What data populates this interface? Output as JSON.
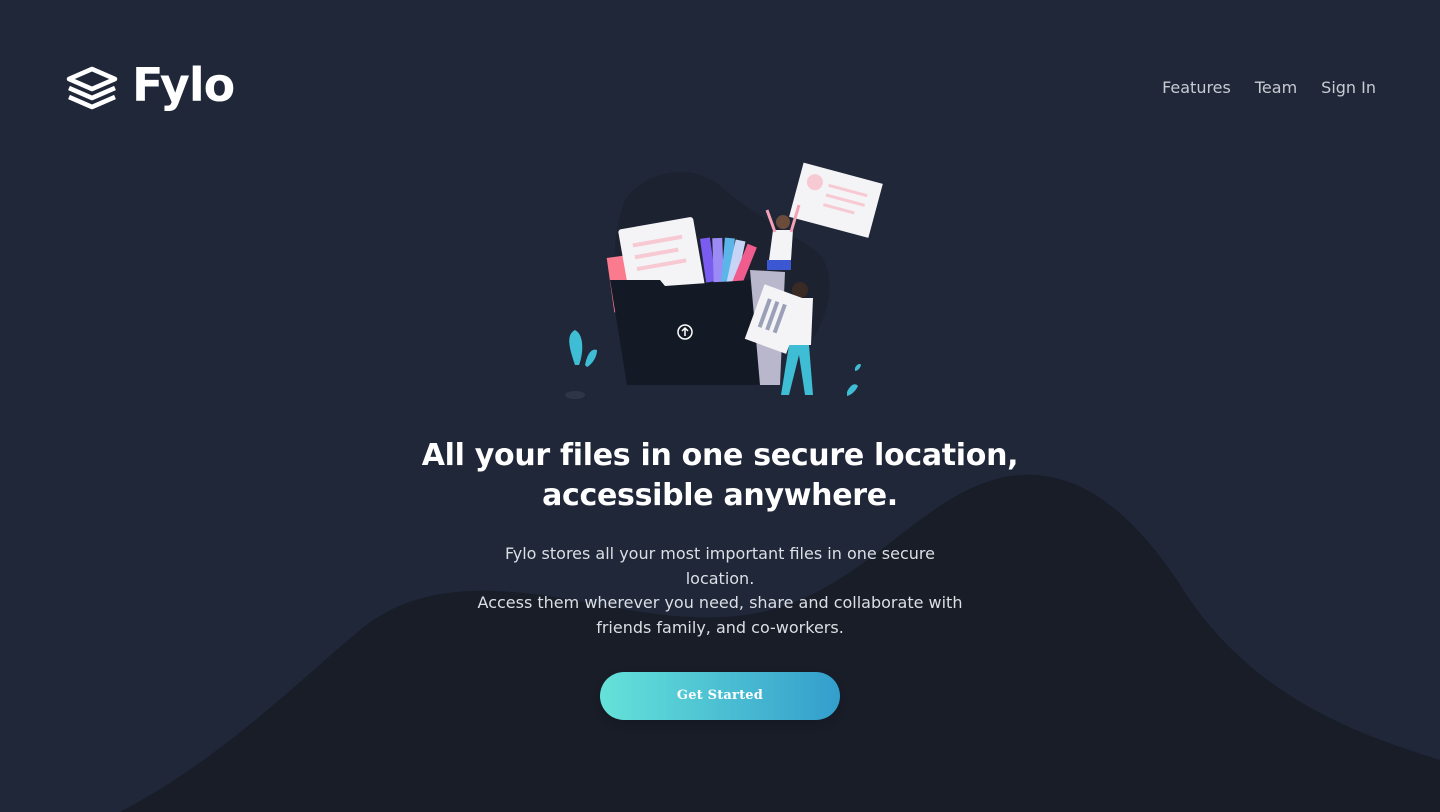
{
  "brand": {
    "name": "Fylo",
    "logo_icon": "stacked-layers-icon"
  },
  "nav": {
    "items": [
      {
        "label": "Features"
      },
      {
        "label": "Team"
      },
      {
        "label": "Sign In"
      }
    ]
  },
  "hero": {
    "illustration": "file-upload-illustration",
    "title_line1": "All your files in one secure location,",
    "title_line2": "accessible anywhere.",
    "subtitle_line1": "Fylo stores all your most important files in one secure location.",
    "subtitle_line2": "Access them wherever you need, share and collaborate with",
    "subtitle_line3": "friends family, and co-workers.",
    "cta_label": "Get Started"
  },
  "colors": {
    "background": "#1f2739",
    "curve": "#181d28",
    "gradient_start": "#65e2d9",
    "gradient_end": "#339ecc",
    "text": "#ffffff",
    "nav_text": "#c7cbd2"
  }
}
